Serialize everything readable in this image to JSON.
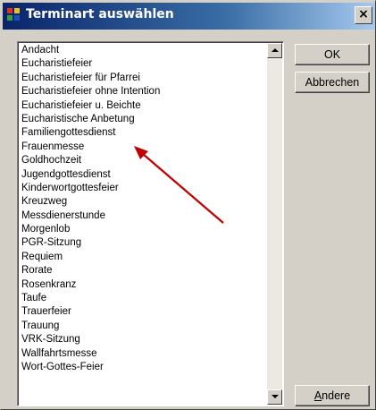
{
  "window": {
    "title": "Terminart auswählen",
    "close_label": "×"
  },
  "list": {
    "items": [
      "Andacht",
      "Eucharistiefeier",
      "Eucharistiefeier für Pfarrei",
      "Eucharistiefeier ohne Intention",
      "Eucharistiefeier u. Beichte",
      "Eucharistische Anbetung",
      "Familiengottesdienst",
      "Frauenmesse",
      "Goldhochzeit",
      "Jugendgottesdienst",
      "Kinderwortgottesfeier",
      "Kreuzweg",
      "Messdienerstunde",
      "Morgenlob",
      "PGR-Sitzung",
      "Requiem",
      "Rorate",
      "Rosenkranz",
      "Taufe",
      "Trauerfeier",
      "Trauung",
      "VRK-Sitzung",
      "Wallfahrtsmesse",
      "Wort-Gottes-Feier"
    ]
  },
  "buttons": {
    "ok": "OK",
    "cancel": "Abbrechen",
    "other_first": "A",
    "other_rest": "ndere"
  },
  "annotation": {
    "color": "#c00000",
    "target": "Familiengottesdienst"
  }
}
